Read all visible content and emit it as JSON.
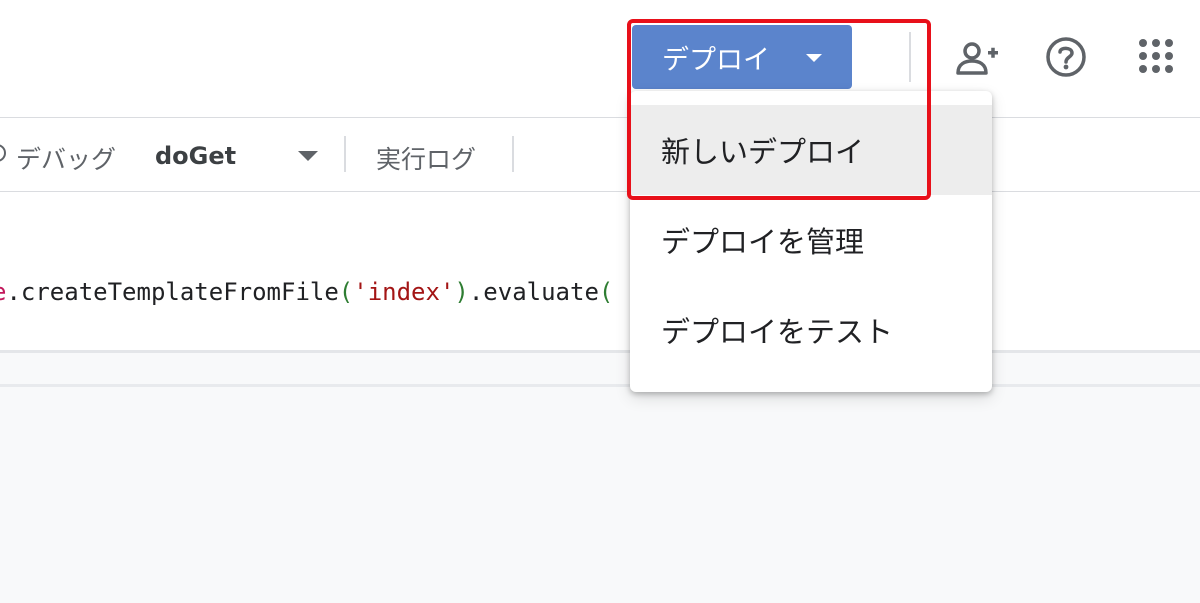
{
  "header": {
    "deploy_button_label": "デプロイ",
    "icons": [
      "add-person-icon",
      "help-icon",
      "apps-grid-icon"
    ]
  },
  "toolbar": {
    "debug_label": "デバッグ",
    "function_name": "doGet",
    "log_label": "実行ログ"
  },
  "editor": {
    "code": {
      "prefix": "e",
      "method": ".createTemplateFromFile",
      "open_paren": "(",
      "string_arg": "'index'",
      "close_paren": ")",
      "tail": ".evaluate",
      "tail_paren": "("
    }
  },
  "deploy_menu": {
    "items": [
      {
        "label": "新しいデプロイ"
      },
      {
        "label": "デプロイを管理"
      },
      {
        "label": "デプロイをテスト"
      }
    ]
  },
  "colors": {
    "deploy_button": "#5b84cc",
    "highlight_border": "#e8101a",
    "menu_hover": "#ededed"
  }
}
